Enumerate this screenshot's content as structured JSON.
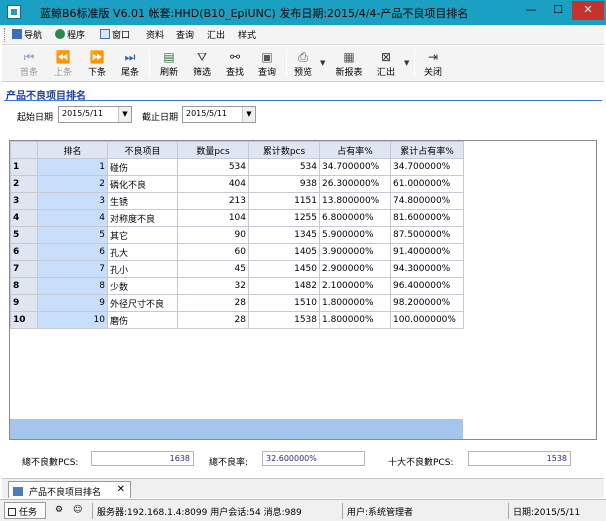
{
  "window": {
    "title": "蓝鲸B6标准版 V6.01 帐套:HHD(B10_EpiUNC) 发布日期:2015/4/4-产品不良项目排名",
    "min_symbol": "—",
    "max_symbol": "☐",
    "close_symbol": "✕"
  },
  "menu": {
    "items": [
      "导航",
      "程序",
      "窗口",
      "资料",
      "查询",
      "汇出",
      "样式"
    ]
  },
  "toolbar": {
    "first": "首条",
    "prev": "上条",
    "next": "下条",
    "last": "尾条",
    "refresh": "刷新",
    "filter": "筛选",
    "find": "查找",
    "query": "查询",
    "preview": "预览",
    "new_report": "新报表",
    "export": "汇出",
    "close": "关闭"
  },
  "report": {
    "title": "产品不良项目排名",
    "start_label": "起始日期",
    "start_date": "2015/5/11",
    "end_label": "截止日期",
    "end_date": "2015/5/11"
  },
  "grid": {
    "columns": [
      "排名",
      "不良项目",
      "数量pcs",
      "累计数pcs",
      "占有率%",
      "累计占有率%"
    ],
    "rows": [
      {
        "idx": "1",
        "rank": "1",
        "item": "碰伤",
        "qty": "534",
        "cum": "534",
        "pct": "34.700000%",
        "cum_pct": "34.700000%"
      },
      {
        "idx": "2",
        "rank": "2",
        "item": "磷化不良",
        "qty": "404",
        "cum": "938",
        "pct": "26.300000%",
        "cum_pct": "61.000000%"
      },
      {
        "idx": "3",
        "rank": "3",
        "item": "生锈",
        "qty": "213",
        "cum": "1151",
        "pct": "13.800000%",
        "cum_pct": "74.800000%"
      },
      {
        "idx": "4",
        "rank": "4",
        "item": "对称度不良",
        "qty": "104",
        "cum": "1255",
        "pct": "6.800000%",
        "cum_pct": "81.600000%"
      },
      {
        "idx": "5",
        "rank": "5",
        "item": "其它",
        "qty": "90",
        "cum": "1345",
        "pct": "5.900000%",
        "cum_pct": "87.500000%"
      },
      {
        "idx": "6",
        "rank": "6",
        "item": "孔大",
        "qty": "60",
        "cum": "1405",
        "pct": "3.900000%",
        "cum_pct": "91.400000%"
      },
      {
        "idx": "7",
        "rank": "7",
        "item": "孔小",
        "qty": "45",
        "cum": "1450",
        "pct": "2.900000%",
        "cum_pct": "94.300000%"
      },
      {
        "idx": "8",
        "rank": "8",
        "item": "少数",
        "qty": "32",
        "cum": "1482",
        "pct": "2.100000%",
        "cum_pct": "96.400000%"
      },
      {
        "idx": "9",
        "rank": "9",
        "item": "外径尺寸不良",
        "qty": "28",
        "cum": "1510",
        "pct": "1.800000%",
        "cum_pct": "98.200000%"
      },
      {
        "idx": "10",
        "rank": "10",
        "item": "磨伤",
        "qty": "28",
        "cum": "1538",
        "pct": "1.800000%",
        "cum_pct": "100.000000%"
      }
    ]
  },
  "summary": {
    "total_defect_label": "總不良數PCS:",
    "total_defect_value": "1638",
    "defect_rate_label": "總不良率:",
    "defect_rate_value": "32.600000%",
    "top10_label": "十大不良數PCS:",
    "top10_value": "1538"
  },
  "tabs": {
    "doc_tab": "产品不良项目排名",
    "close_symbol": "✕"
  },
  "status": {
    "task": "任务",
    "server": "服务器:192.168.1.4:8099 用户会话:54 消息:989",
    "user": "用户:系统管理者",
    "date": "日期:2015/5/11"
  },
  "colors": {
    "titlebar": "#1aa0c2",
    "close_button": "#c7312c",
    "header_blue": "#1a3faa",
    "selection": "#c9defa",
    "grid_header": "#dfe6f2",
    "grid_footer": "#a4c5ee"
  }
}
